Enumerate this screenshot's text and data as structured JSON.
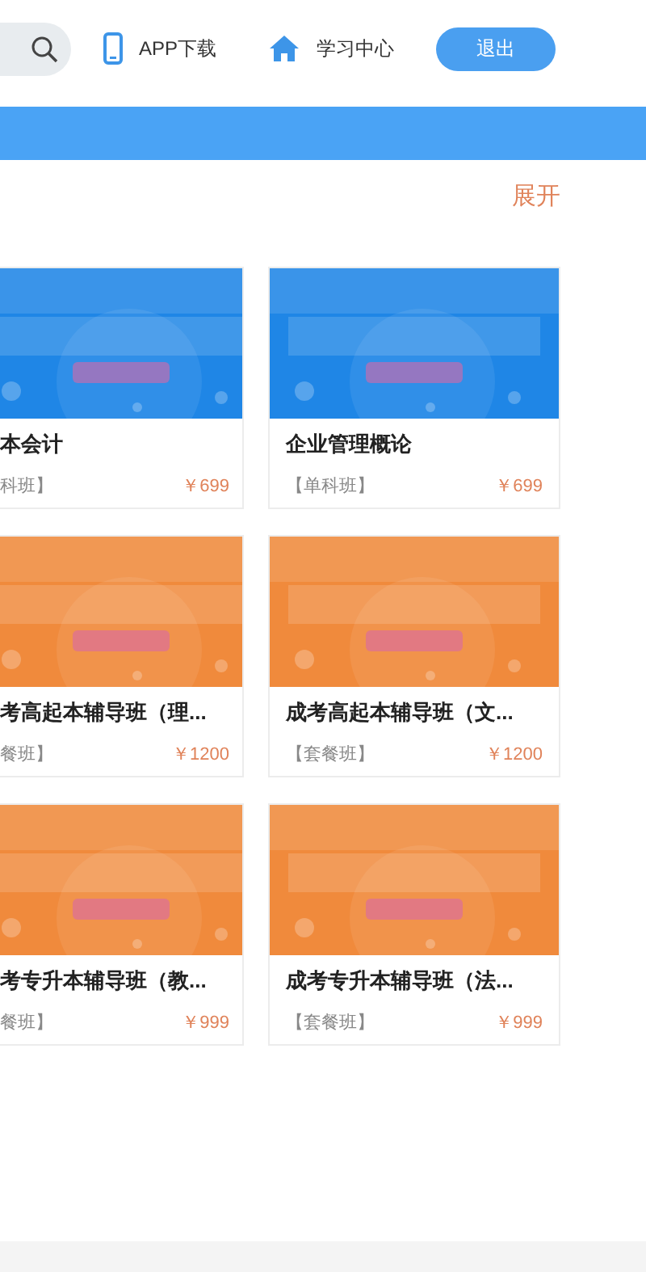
{
  "header": {
    "nav": [
      {
        "kind": "phone",
        "label": "APP下载"
      },
      {
        "kind": "home",
        "label": "学习中心"
      }
    ],
    "logout": "退出"
  },
  "section": {
    "toggle": "展开"
  },
  "courses": [
    {
      "color": "#1f86e6",
      "title": "本会计",
      "tag": "科班】",
      "price": "￥699"
    },
    {
      "color": "#1f86e6",
      "title": "企业管理概论",
      "tag": "【单科班】",
      "price": "￥699"
    },
    {
      "color": "#f08a3c",
      "title": "考高起本辅导班（理...",
      "tag": "餐班】",
      "price": "￥1200"
    },
    {
      "color": "#f08a3c",
      "title": "成考高起本辅导班（文...",
      "tag": "【套餐班】",
      "price": "￥1200"
    },
    {
      "color": "#f08a3c",
      "title": "考专升本辅导班（教...",
      "tag": "餐班】",
      "price": "￥999"
    },
    {
      "color": "#f08a3c",
      "title": "成考专升本辅导班（法...",
      "tag": "【套餐班】",
      "price": "￥999"
    }
  ]
}
